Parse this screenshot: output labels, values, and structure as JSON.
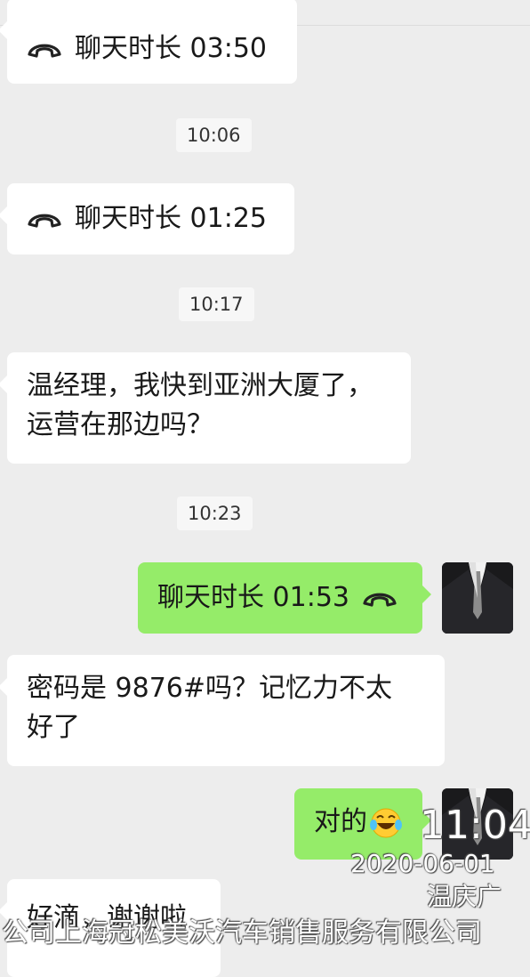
{
  "messages": {
    "call1": "聊天时长 03:50",
    "time1": "10:06",
    "call2": "聊天时长 01:25",
    "time2": "10:17",
    "text1_line1": "温经理，我快到亚洲大厦了，",
    "text1_line2": "运营在那边吗？",
    "time3": "10:23",
    "call3": "聊天时长 01:53",
    "text2_line1": "密码是 9876#吗？记忆力不太",
    "text2_line2": "好了",
    "reply": "对的",
    "text3": "好滴，谢谢啦"
  },
  "watermark": {
    "time": "11:04",
    "date": "2020-06-01",
    "name": "温庆广",
    "company": "公司上海冠松美沃汽车销售服务有限公司"
  },
  "icons": {
    "call": "phone-hangup-icon",
    "emoji": "tears-of-joy-emoji",
    "avatar": "suited-man-avatar"
  },
  "colors": {
    "background": "#ededed",
    "incoming_bubble": "#ffffff",
    "outgoing_bubble": "#95ec69",
    "timestamp_bg": "#f7f7f7"
  }
}
